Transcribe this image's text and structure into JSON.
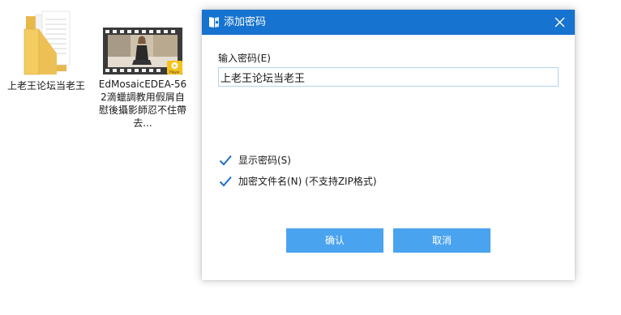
{
  "desktop": {
    "items": [
      {
        "label": "上老王论坛当老王",
        "icon": "folder-icon"
      },
      {
        "label": "EdMosaicEDEA-562滴蠟調教用假屑自慰後攝影師忍不住帶去...",
        "icon": "video-thumbnail-icon",
        "badge": "Player"
      }
    ]
  },
  "dialog": {
    "title": "添加密码",
    "title_icon": "password-book-icon",
    "close_icon": "close-icon",
    "input_label": "输入密码(E)",
    "password_value": "上老王论坛当老王",
    "show_password": {
      "label": "显示密码(S)",
      "checked": true
    },
    "encrypt_filenames": {
      "label": "加密文件名(N) (不支持ZIP格式)",
      "checked": true
    },
    "ok_label": "确认",
    "cancel_label": "取消"
  },
  "colors": {
    "titlebar": "#1673cf",
    "button": "#4aa3ef",
    "checkmark": "#1e6fd0",
    "input_border": "#b2d4f0"
  }
}
